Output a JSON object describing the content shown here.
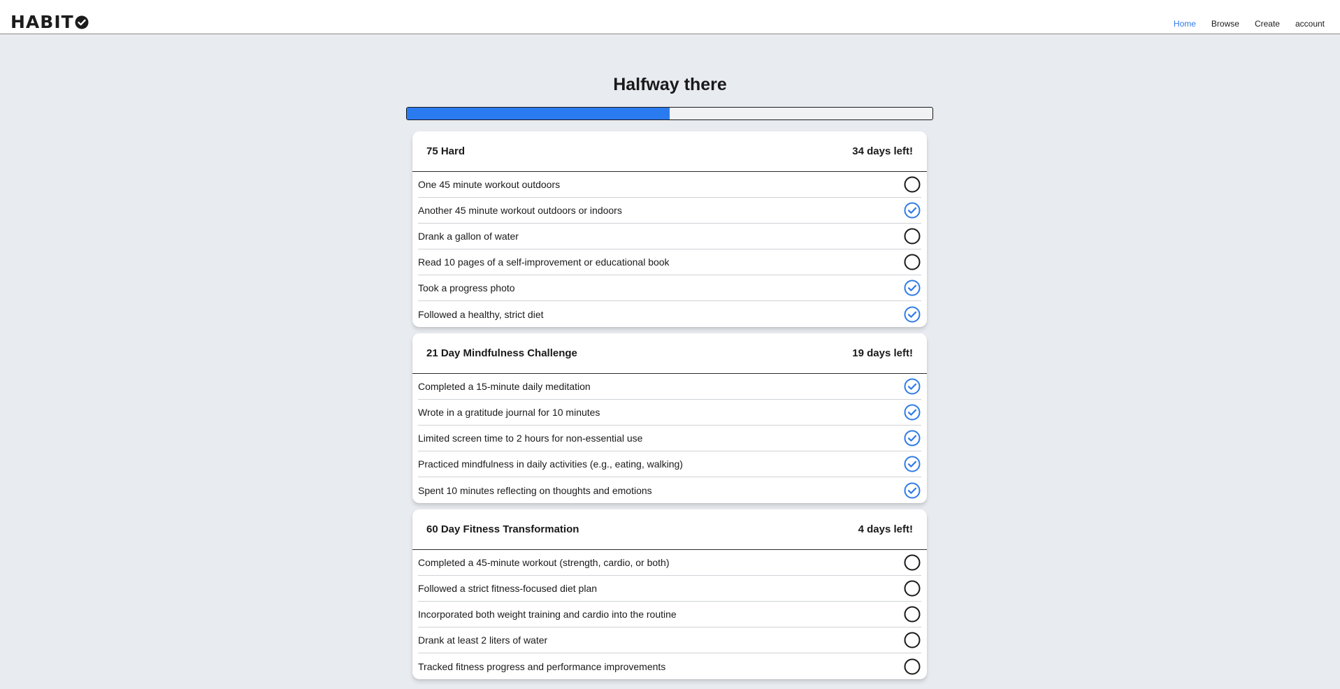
{
  "app": {
    "logo_text": "HABIT"
  },
  "nav": {
    "items": [
      {
        "label": "Home",
        "active": true
      },
      {
        "label": "Browse",
        "active": false
      },
      {
        "label": "Create",
        "active": false
      },
      {
        "label": "account",
        "active": false
      }
    ]
  },
  "summary": {
    "headline": "Halfway there",
    "progress": 0.5
  },
  "colors": {
    "accent": "#2a7af0",
    "done_check": "#2f7be8",
    "background": "#e8ebf0"
  },
  "challenges": [
    {
      "title": "75 Hard",
      "days_left": "34 days left!",
      "tasks": [
        {
          "label": "One 45 minute workout outdoors",
          "done": false
        },
        {
          "label": "Another 45 minute workout outdoors or indoors",
          "done": true
        },
        {
          "label": "Drank a gallon of water",
          "done": false
        },
        {
          "label": "Read 10 pages of a self-improvement or educational book",
          "done": false
        },
        {
          "label": "Took a progress photo",
          "done": true
        },
        {
          "label": "Followed a healthy, strict diet",
          "done": true
        }
      ]
    },
    {
      "title": "21 Day Mindfulness Challenge",
      "days_left": "19 days left!",
      "tasks": [
        {
          "label": "Completed a 15-minute daily meditation",
          "done": true
        },
        {
          "label": "Wrote in a gratitude journal for 10 minutes",
          "done": true
        },
        {
          "label": "Limited screen time to 2 hours for non-essential use",
          "done": true
        },
        {
          "label": "Practiced mindfulness in daily activities (e.g., eating, walking)",
          "done": true
        },
        {
          "label": "Spent 10 minutes reflecting on thoughts and emotions",
          "done": true
        }
      ]
    },
    {
      "title": "60 Day Fitness Transformation",
      "days_left": "4 days left!",
      "tasks": [
        {
          "label": "Completed a 45-minute workout (strength, cardio, or both)",
          "done": false
        },
        {
          "label": "Followed a strict fitness-focused diet plan",
          "done": false
        },
        {
          "label": "Incorporated both weight training and cardio into the routine",
          "done": false
        },
        {
          "label": "Drank at least 2 liters of water",
          "done": false
        },
        {
          "label": "Tracked fitness progress and performance improvements",
          "done": false
        }
      ]
    }
  ]
}
